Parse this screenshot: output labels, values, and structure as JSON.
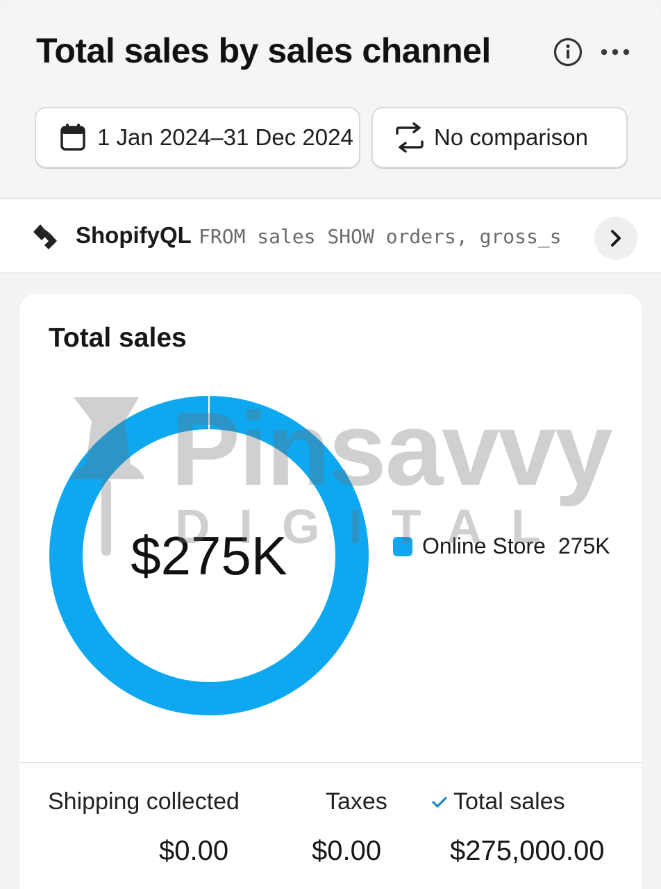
{
  "header": {
    "title": "Total sales by sales channel",
    "date_range": "1 Jan 2024–31 Dec 2024",
    "comparison": "No comparison"
  },
  "query_bar": {
    "name": "ShopifyQL",
    "query": "FROM sales SHOW orders, gross_s"
  },
  "card": {
    "title": "Total sales",
    "center_value": "$275K"
  },
  "chart_data": {
    "type": "pie",
    "categories": [
      "Online Store"
    ],
    "values": [
      275000
    ],
    "legend_labels": [
      "275K"
    ],
    "legend_position": "right",
    "colors": [
      "#0ea8f0"
    ]
  },
  "metrics": [
    {
      "label": "Shipping collected",
      "value": "$0.00",
      "selected": false
    },
    {
      "label": "Taxes",
      "value": "$0.00",
      "selected": false
    },
    {
      "label": "Total sales",
      "value": "$275,000.00",
      "selected": true
    }
  ],
  "watermark": {
    "brand": "Pinsavvy",
    "sub": "DIGITAL"
  },
  "icons": {
    "info": "info-icon",
    "more": "more-horizontal-icon",
    "calendar": "calendar-icon",
    "compare": "compare-arrows-icon",
    "query_logo": "shopifyql-logo-icon",
    "next": "chevron-right-icon",
    "check": "checkmark-icon"
  },
  "colors": {
    "accent": "#0ea8f0",
    "check": "#1f86c6"
  }
}
